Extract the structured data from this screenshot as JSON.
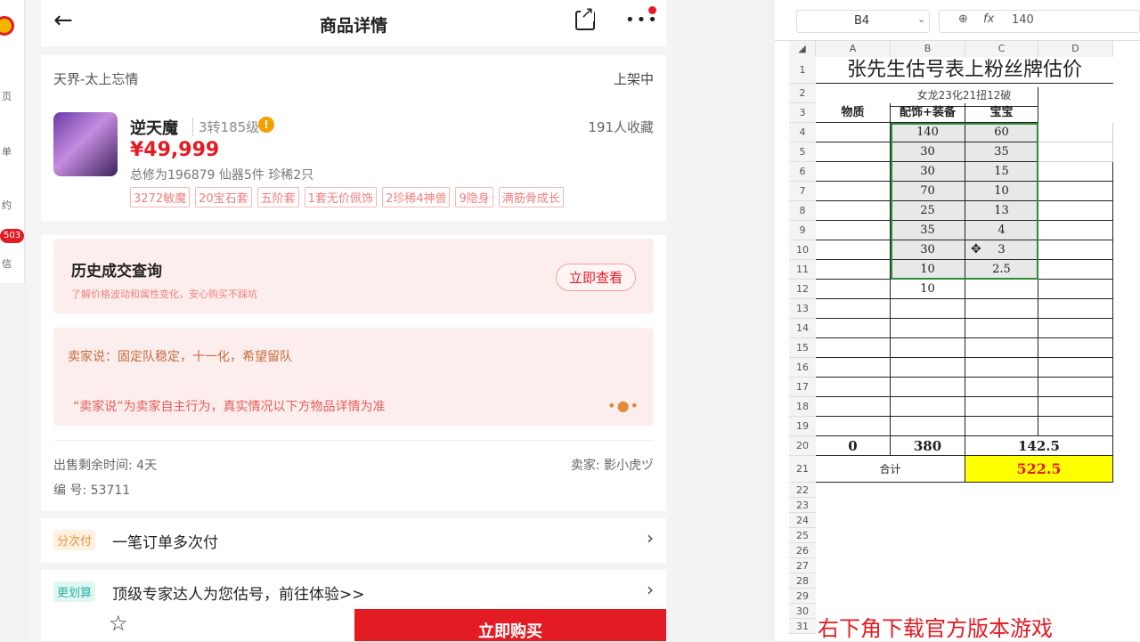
{
  "sidebar": {
    "items": [
      "页",
      "单",
      "约",
      "信"
    ],
    "badge": "503"
  },
  "app": {
    "title": "商品详情",
    "server": "天界-太上忘情",
    "status": "上架中",
    "char_name": "逆天魔",
    "level": "3转185级",
    "favorites": "191人收藏",
    "price": "¥49,999",
    "stats": "总修为196879  仙器5件  珍稀2只",
    "tags": [
      "3272敏魔",
      "20宝石套",
      "五阶套",
      "1套无价佩饰",
      "2珍稀4神兽",
      "9隐身",
      "满筋骨成长"
    ],
    "history_title": "历史成交查询",
    "history_sub": "了解价格波动和属性变化，安心购买不踩坑",
    "history_btn": "立即查看",
    "seller_say": "卖家说：固定队稳定，十一化，希望留队",
    "disclaimer": "“卖家说”为卖家自主行为，真实情况以下方物品详情为准",
    "time_left": "出售剩余时间: 4天",
    "seller": "卖家: 影小虎ヅ",
    "serial": "编 号: 53711",
    "pay_chip": "分次付",
    "pay_text": "一笔订单多次付",
    "eval_chip": "更划算",
    "eval_text": "顶级专家达人为您估号，前往体验>>",
    "buy_btn": "立即购买"
  },
  "sheet": {
    "cell_ref": "B4",
    "formula_value": "140",
    "columns": [
      "A",
      "B",
      "C",
      "D"
    ],
    "title": "张先生估号表上粉丝牌估价",
    "subtitle": "女龙23化21扭12破",
    "headers": [
      "物质",
      "配饰+装备",
      "宝宝"
    ],
    "col_b": [
      "140",
      "30",
      "30",
      "70",
      "25",
      "35",
      "30",
      "10",
      "10"
    ],
    "col_c": [
      "60",
      "35",
      "15",
      "10",
      "13",
      "4",
      "3",
      "2.5"
    ],
    "totals": {
      "a": "0",
      "b": "380",
      "c": "142.5"
    },
    "sum_label": "合计",
    "sum_value": "522.5",
    "row_numbers": [
      "1",
      "2",
      "3",
      "4",
      "5",
      "6",
      "7",
      "8",
      "9",
      "10",
      "11",
      "12",
      "13",
      "14",
      "15",
      "16",
      "17",
      "18",
      "19",
      "20",
      "21",
      "22",
      "23",
      "24",
      "25",
      "26",
      "27",
      "28",
      "29",
      "30",
      "31"
    ]
  },
  "watermark": "右下角下载官方版本游戏"
}
